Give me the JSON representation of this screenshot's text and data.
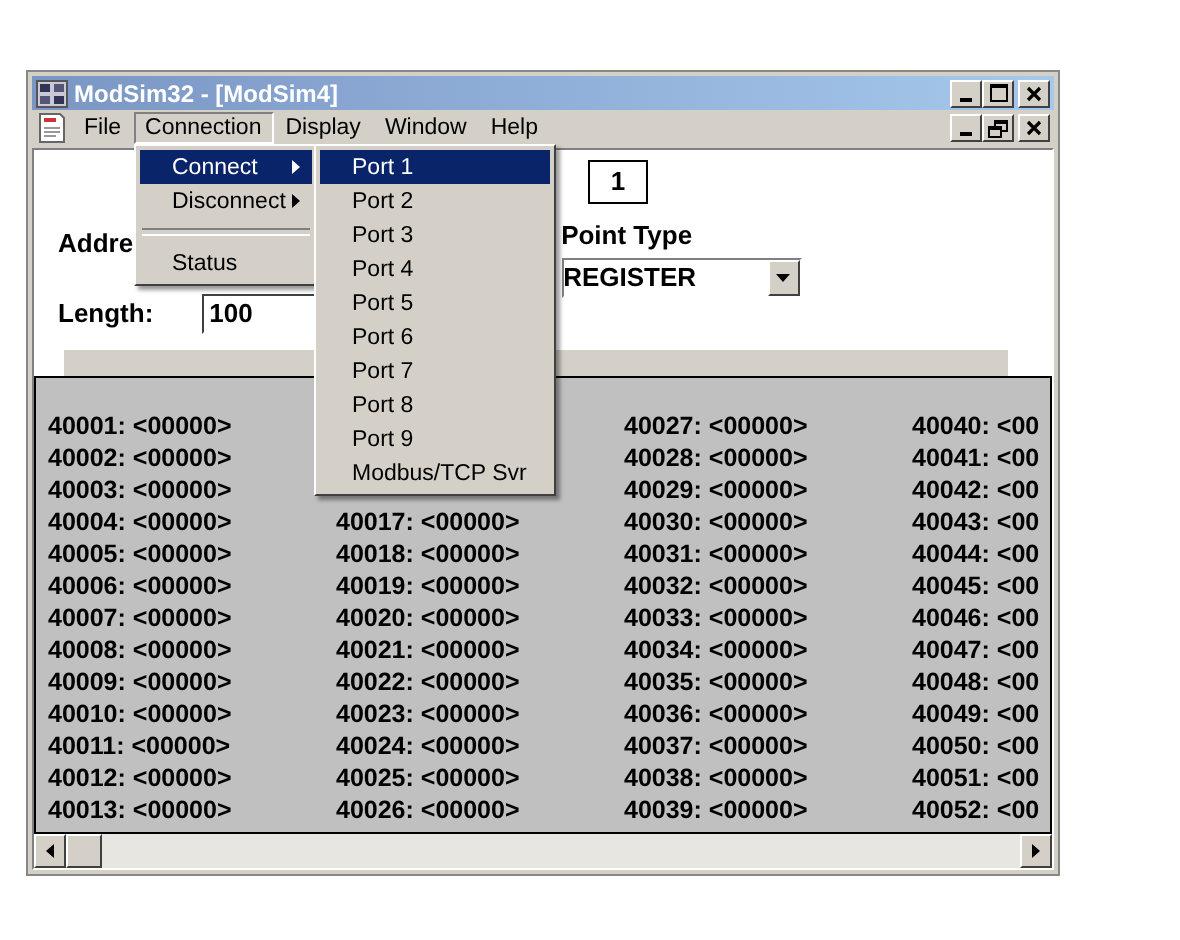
{
  "window": {
    "title": "ModSim32 - [ModSim4]"
  },
  "menu_bar": [
    {
      "label": "File",
      "selected": false
    },
    {
      "label": "Connection",
      "selected": true
    },
    {
      "label": "Display",
      "selected": false
    },
    {
      "label": "Window",
      "selected": false
    },
    {
      "label": "Help",
      "selected": false
    }
  ],
  "form": {
    "device_id": "1",
    "address_label": "Addre",
    "point_type_label": "Point Type",
    "point_type": "REGISTER",
    "length_label": "Length:",
    "length": "100"
  },
  "registers": [
    [
      "40001: <00000>",
      "40002: <00000>",
      "40003: <00000>",
      "40004: <00000>",
      "40005: <00000>",
      "40006: <00000>",
      "40007: <00000>",
      "40008: <00000>",
      "40009: <00000>",
      "40010: <00000>",
      "40011: <00000>",
      "40012: <00000>",
      "40013: <00000>"
    ],
    [
      "40017: <00000>",
      "40018: <00000>",
      "40019: <00000>",
      "40020: <00000>",
      "40021: <00000>",
      "40022: <00000>",
      "40023: <00000>",
      "40024: <00000>",
      "40025: <00000>",
      "40026: <00000>"
    ],
    [
      "40027: <00000>",
      "40028: <00000>",
      "40029: <00000>",
      "40030: <00000>",
      "40031: <00000>",
      "40032: <00000>",
      "40033: <00000>",
      "40034: <00000>",
      "40035: <00000>",
      "40036: <00000>",
      "40037: <00000>",
      "40038: <00000>",
      "40039: <00000>"
    ],
    [
      "40040: <00",
      "40041: <00",
      "40042: <00",
      "40043: <00",
      "40044: <00",
      "40045: <00",
      "40046: <00",
      "40047: <00",
      "40048: <00",
      "40049: <00",
      "40050: <00",
      "40051: <00",
      "40052: <00"
    ]
  ],
  "connection_menu": [
    {
      "kind": "submenu",
      "label": "Connect",
      "selected": true
    },
    {
      "kind": "submenu",
      "label": "Disconnect",
      "selected": false
    },
    {
      "kind": "separator"
    },
    {
      "kind": "item",
      "label": "Status",
      "selected": false
    }
  ],
  "connect_submenu": [
    {
      "label": "Port 1",
      "selected": true
    },
    {
      "label": "Port 2",
      "selected": false
    },
    {
      "label": "Port 3",
      "selected": false
    },
    {
      "label": "Port 4",
      "selected": false
    },
    {
      "label": "Port 5",
      "selected": false
    },
    {
      "label": "Port 6",
      "selected": false
    },
    {
      "label": "Port 7",
      "selected": false
    },
    {
      "label": "Port 8",
      "selected": false
    },
    {
      "label": "Port 9",
      "selected": false
    },
    {
      "label": "Modbus/TCP Svr",
      "selected": false
    }
  ]
}
